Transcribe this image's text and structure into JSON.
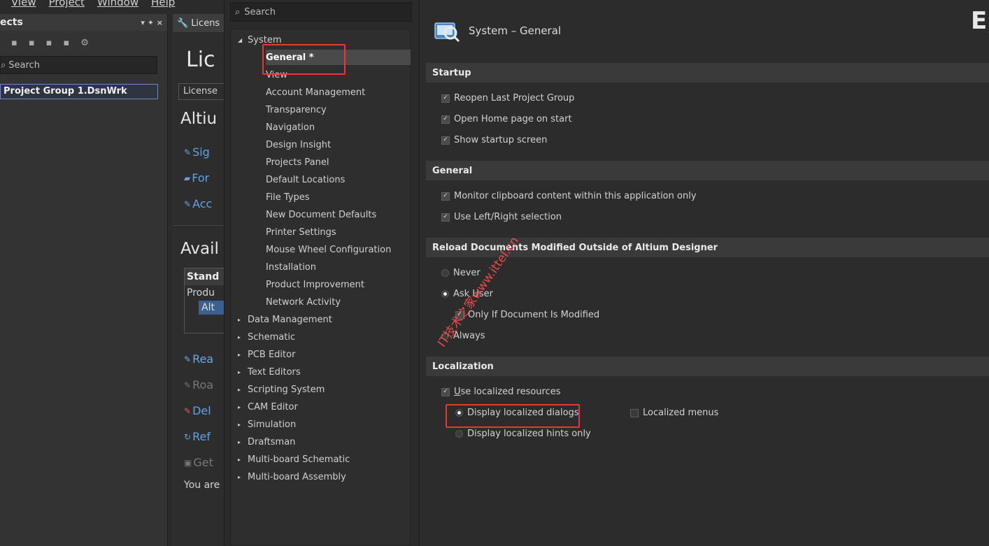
{
  "menubar": {
    "items": [
      "View",
      "Project",
      "Window",
      "Help"
    ]
  },
  "projects_panel": {
    "title": "ects",
    "pin_glyph": "▾ ✦ ×",
    "search_placeholder": "Search",
    "items": [
      "Project Group 1.DsnWrk"
    ]
  },
  "license_page": {
    "tab_label": "Licens",
    "title": "Lic",
    "subtab": "License",
    "heading": "Altiu",
    "links": [
      "Sig",
      "For",
      "Acc"
    ],
    "available_heading": "Avail",
    "table_header": "Stand",
    "table_row": "Produ",
    "table_selected": "Alt",
    "actions": [
      "Rea",
      "Roa",
      "Del",
      "Ref",
      "Get"
    ],
    "footer_text": "You are"
  },
  "tree": {
    "search_placeholder": "Search",
    "system_label": "System",
    "system_children": [
      "General *",
      "View",
      "Account Management",
      "Transparency",
      "Navigation",
      "Design Insight",
      "Projects Panel",
      "Default Locations",
      "File Types",
      "New Document Defaults",
      "Printer Settings",
      "Mouse Wheel Configuration",
      "Installation",
      "Product Improvement",
      "Network Activity"
    ],
    "categories": [
      "Data Management",
      "Schematic",
      "PCB Editor",
      "Text Editors",
      "Scripting System",
      "CAM Editor",
      "Simulation",
      "Draftsman",
      "Multi-board Schematic",
      "Multi-board Assembly"
    ]
  },
  "content": {
    "title": "System – General",
    "corner_letter": "E",
    "sections": {
      "startup": {
        "heading": "Startup",
        "options": [
          {
            "label": "Reopen Last Project Group",
            "checked": true
          },
          {
            "label": "Open Home page on start",
            "checked": true
          },
          {
            "label": "Show startup screen",
            "checked": true
          }
        ]
      },
      "general": {
        "heading": "General",
        "options": [
          {
            "label": "Monitor clipboard content within this application only",
            "checked": true
          },
          {
            "label": "Use Left/Right selection",
            "checked": true
          }
        ]
      },
      "reload": {
        "heading": "Reload Documents Modified Outside of Altium Designer",
        "never": "Never",
        "ask_user": "Ask User",
        "only_if_modified": "Only If Document Is Modified",
        "always": "Always",
        "selected": "Ask User"
      },
      "localization": {
        "heading": "Localization",
        "use_localized": "Use localized resources",
        "display_dialogs": "Display localized dialogs",
        "display_hints": "Display localized hints only",
        "localized_menus": "Localized menus",
        "use_localized_checked": true,
        "localized_menus_checked": false,
        "selected": "Display localized dialogs"
      }
    }
  },
  "watermark": "IT技术之家www.ittel.cn",
  "colors": {
    "highlight_box": "#e53935",
    "selection_blue": "#3d5f8f"
  },
  "icons": [
    "search-icon",
    "wrench-icon",
    "gear-icon",
    "preferences-icon",
    "expand-arrow-icon"
  ]
}
